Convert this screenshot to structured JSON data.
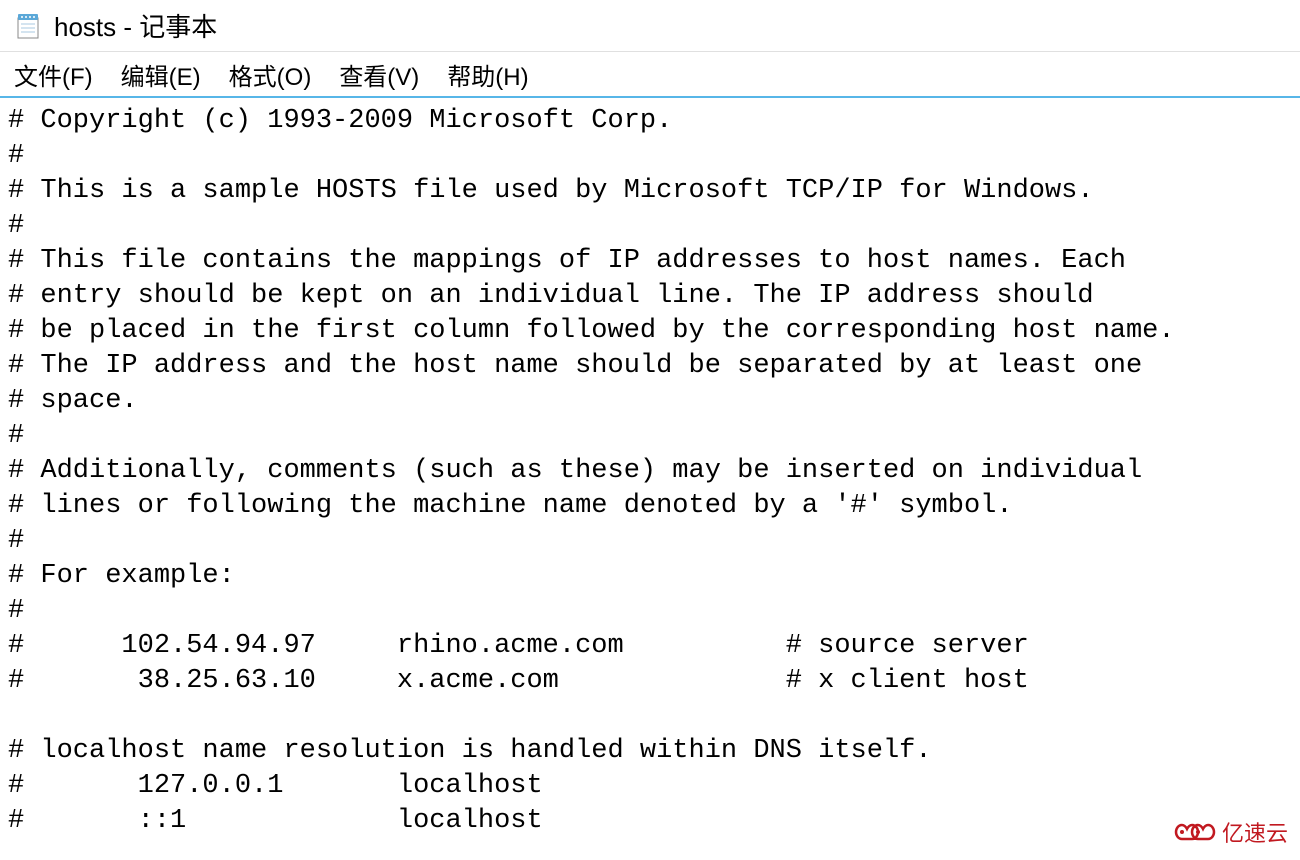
{
  "window": {
    "title": "hosts - 记事本"
  },
  "menu": {
    "file": "文件(F)",
    "edit": "编辑(E)",
    "format": "格式(O)",
    "view": "查看(V)",
    "help": "帮助(H)"
  },
  "content": "# Copyright (c) 1993-2009 Microsoft Corp.\n#\n# This is a sample HOSTS file used by Microsoft TCP/IP for Windows.\n#\n# This file contains the mappings of IP addresses to host names. Each\n# entry should be kept on an individual line. The IP address should\n# be placed in the first column followed by the corresponding host name.\n# The IP address and the host name should be separated by at least one\n# space.\n#\n# Additionally, comments (such as these) may be inserted on individual\n# lines or following the machine name denoted by a '#' symbol.\n#\n# For example:\n#\n#      102.54.94.97     rhino.acme.com          # source server\n#       38.25.63.10     x.acme.com              # x client host\n\n# localhost name resolution is handled within DNS itself.\n#       127.0.0.1       localhost\n#       ::1             localhost",
  "watermark": {
    "text": "亿速云"
  }
}
